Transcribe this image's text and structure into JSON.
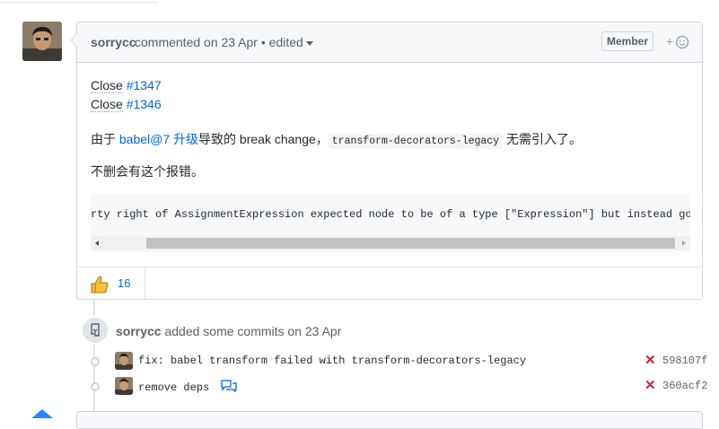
{
  "comment": {
    "author": "sorrycc",
    "meta": "commented on 23 Apr • edited",
    "badge": "Member",
    "reaction_add": "+",
    "closes": [
      {
        "keyword": "Close",
        "issue": "#1347"
      },
      {
        "keyword": "Close",
        "issue": "#1346"
      }
    ],
    "para1": {
      "prefix": "由于 ",
      "link": "babel@7 升级",
      "middle": "导致的 break change，",
      "code": "transform-decorators-legacy",
      "suffix": " 无需引入了。"
    },
    "para2": "不删会有这个报错。",
    "code_line": "rty right of AssignmentExpression expected node to be of a type [\"Expression\"] but instead got null",
    "reaction": {
      "icon": "thumbs-up",
      "count": "16"
    }
  },
  "event": {
    "author": "sorrycc",
    "text": " added some commits on 23 Apr"
  },
  "commits": [
    {
      "message": "fix: babel transform failed with transform-decorators-legacy",
      "status": "✕",
      "sha": "598107f",
      "has_comment_icon": false
    },
    {
      "message": "remove deps",
      "status": "✕",
      "sha": "360acf2",
      "has_comment_icon": true
    }
  ],
  "colors": {
    "link": "#0366d6",
    "fail": "#cb2431",
    "thumb": "#f5c33b"
  }
}
